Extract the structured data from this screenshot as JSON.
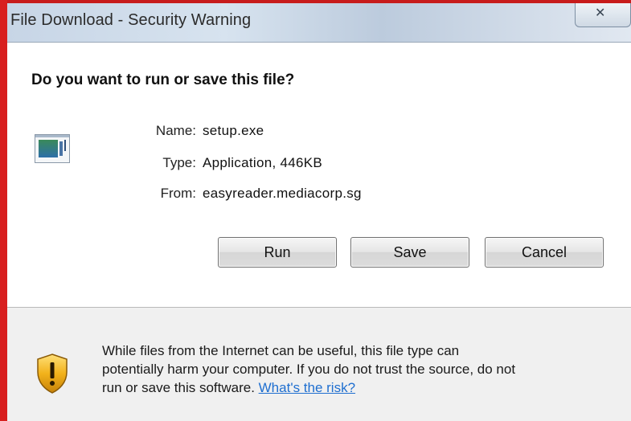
{
  "window": {
    "title": "File Download - Security Warning"
  },
  "dialog": {
    "heading": "Do you want to run or save this file?",
    "info": {
      "name_label": "Name:",
      "name_value": "setup.exe",
      "type_label": "Type:",
      "type_value": "Application, 446KB",
      "from_label": "From:",
      "from_value": "easyreader.mediacorp.sg"
    },
    "buttons": {
      "run": "Run",
      "save": "Save",
      "cancel": "Cancel"
    },
    "warning": {
      "line1": "While files from the Internet can be useful, this file type can",
      "line2": "potentially harm your computer. If you do not trust the source, do not",
      "line3_prefix": "run or save this software. ",
      "risk_link": "What's the risk?"
    }
  },
  "icons": {
    "file": "application-file-icon",
    "shield": "warning-shield-icon",
    "close": "close-icon"
  },
  "colors": {
    "border_red": "#d81f1f",
    "link_blue": "#1f6fd0",
    "shield_gold": "#f2b21b"
  }
}
